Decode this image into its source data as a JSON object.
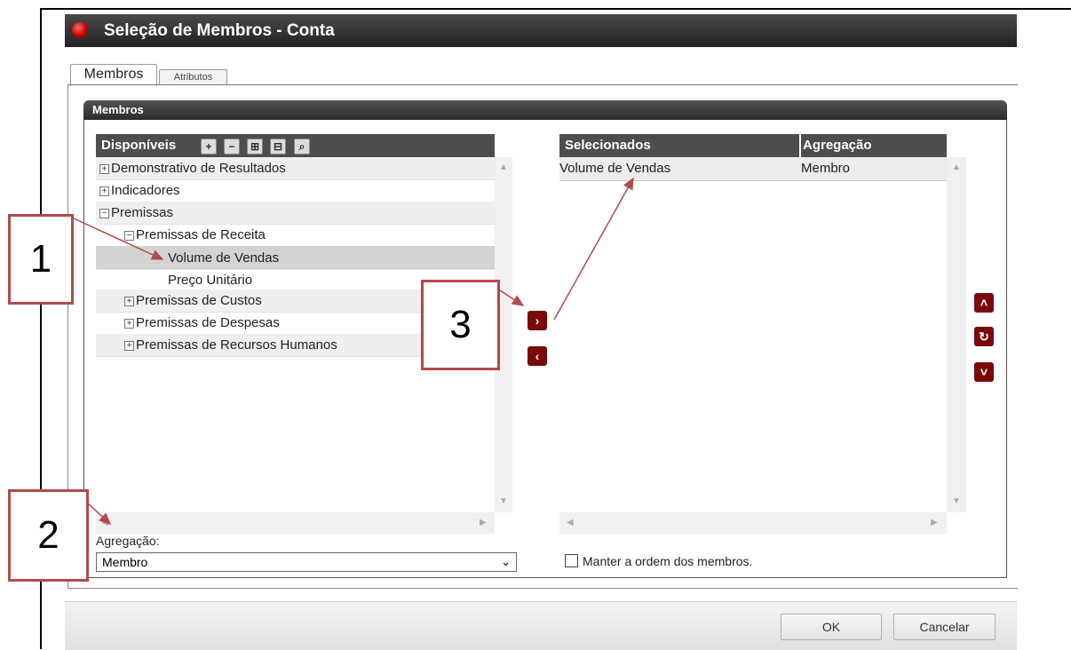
{
  "window": {
    "title": "Seleção de Membros - Conta"
  },
  "tabs": [
    {
      "label": "Membros"
    },
    {
      "label": "Atributos"
    }
  ],
  "group": {
    "title": "Membros"
  },
  "available": {
    "header": "Disponíveis",
    "toolbar_icons": [
      "expand-all-icon",
      "collapse-all-icon",
      "add-children-icon",
      "remove-children-icon",
      "search-icon"
    ],
    "items": [
      {
        "label": "Demonstrativo de Resultados",
        "expander": "+"
      },
      {
        "label": "Indicadores",
        "expander": "+"
      },
      {
        "label": "Premissas",
        "expander": "−"
      },
      {
        "label": "Premissas de Receita",
        "expander": "−"
      },
      {
        "label": "Volume de Vendas",
        "expander": ""
      },
      {
        "label": "Preço Unitário",
        "expander": ""
      },
      {
        "label": "Premissas de Custos",
        "expander": "+"
      },
      {
        "label": "Premissas de Despesas",
        "expander": "+"
      },
      {
        "label": "Premissas de Recursos Humanos",
        "expander": "+"
      }
    ]
  },
  "aggregation": {
    "label": "Agregação:",
    "value": "Membro"
  },
  "selected": {
    "columns": [
      "Selecionados",
      "Agregação"
    ],
    "rows": [
      {
        "member": "Volume de Vendas",
        "aggregation": "Membro"
      }
    ]
  },
  "keep_order": {
    "label": "Manter a ordem dos membros.",
    "checked": false
  },
  "buttons": {
    "ok": "OK",
    "cancel": "Cancelar"
  },
  "annotations": [
    "1",
    "2",
    "3"
  ],
  "colors": {
    "accent": "#7a0a0a",
    "annotation": "#b44a4a"
  }
}
